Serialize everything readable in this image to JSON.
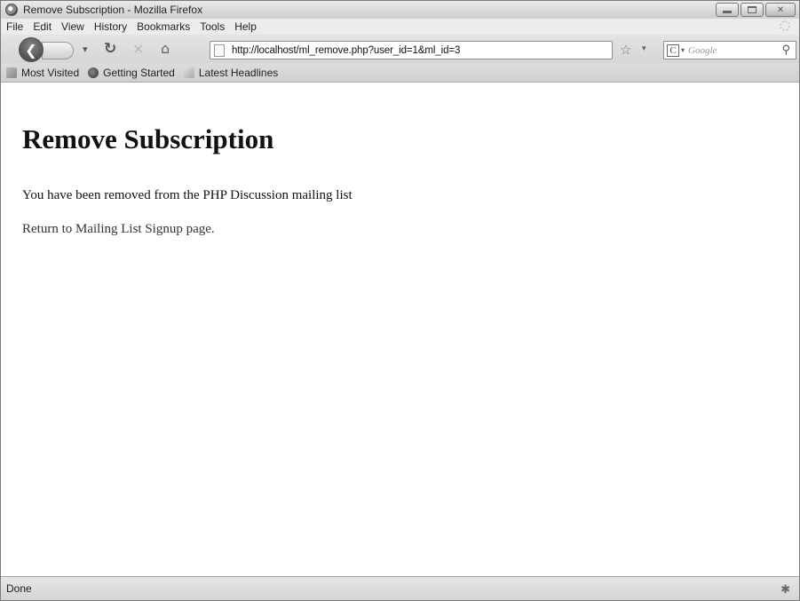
{
  "window": {
    "title": "Remove Subscription - Mozilla Firefox"
  },
  "menu": {
    "items": [
      "File",
      "Edit",
      "View",
      "History",
      "Bookmarks",
      "Tools",
      "Help"
    ]
  },
  "navigation": {
    "url": "http://localhost/ml_remove.php?user_id=1&ml_id=3",
    "search_engine_icon": "C",
    "search_placeholder": "Google"
  },
  "bookmarks": {
    "items": [
      {
        "label": "Most Visited",
        "icon": "most-visited-icon"
      },
      {
        "label": "Getting Started",
        "icon": "getting-started-icon"
      },
      {
        "label": "Latest Headlines",
        "icon": "rss-feed-icon"
      }
    ]
  },
  "page": {
    "heading": "Remove Subscription",
    "message": "You have been removed from the PHP Discussion mailing list",
    "link_text": "Return to Mailing List Signup page."
  },
  "status": {
    "text": "Done"
  }
}
